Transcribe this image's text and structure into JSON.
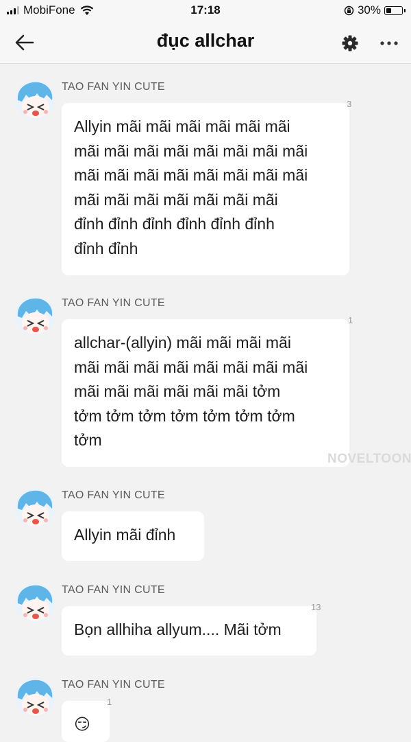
{
  "status_bar": {
    "carrier": "MobiFone",
    "time": "17:18",
    "battery": "30%"
  },
  "header": {
    "title": "đục allchar",
    "back_icon": "arrow-left-icon",
    "settings_icon": "gear-icon",
    "more_icon": "more-dots-icon"
  },
  "watermark": "NOVELTOON",
  "messages": [
    {
      "sender": "TAO FAN YIN CUTE",
      "count": "3",
      "lines": [
        "Allyin mãi mãi mãi mãi mãi mãi",
        "mãi mãi mãi mãi mãi mãi mãi mãi",
        "mãi mãi mãi mãi mãi mãi mãi mãi",
        "mãi mãi mãi mãi mãi mãi mãi",
        "đỉnh đỉnh đỉnh đỉnh đỉnh đỉnh",
        "đỉnh đỉnh"
      ]
    },
    {
      "sender": "TAO FAN YIN CUTE",
      "count": "1",
      "lines": [
        "allchar-(allyin) mãi mãi mãi mãi",
        "mãi mãi mãi mãi mãi mãi mãi mãi",
        "mãi mãi mãi mãi mãi mãi tởm",
        "tởm tởm tởm tởm tởm tởm tởm",
        "tởm"
      ]
    },
    {
      "sender": "TAO FAN YIN CUTE",
      "count": "",
      "lines": [
        "Allyin mãi đỉnh"
      ]
    },
    {
      "sender": "TAO FAN YIN CUTE",
      "count": "13",
      "lines": [
        "Bọn allhiha allyum.... Mãi tởm"
      ]
    },
    {
      "sender": "TAO FAN YIN CUTE",
      "count": "1",
      "lines": [
        "😏"
      ]
    }
  ]
}
